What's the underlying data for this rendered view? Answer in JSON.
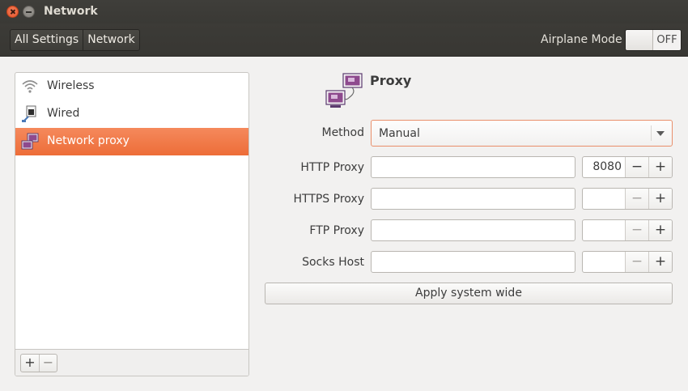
{
  "window": {
    "title": "Network"
  },
  "header": {
    "breadcrumbs": [
      "All Settings",
      "Network"
    ],
    "airplane_mode_label": "Airplane Mode",
    "airplane_mode_state": "OFF"
  },
  "sidebar": {
    "items": [
      {
        "label": "Wireless",
        "icon": "wifi-icon",
        "selected": false
      },
      {
        "label": "Wired",
        "icon": "wired-network-icon",
        "selected": false
      },
      {
        "label": "Network proxy",
        "icon": "network-proxy-icon",
        "selected": true
      }
    ],
    "add_label": "+",
    "remove_label": "−"
  },
  "proxy": {
    "title": "Proxy",
    "method_label": "Method",
    "method_value": "Manual",
    "rows": [
      {
        "label": "HTTP Proxy",
        "host": "",
        "port": "8080"
      },
      {
        "label": "HTTPS Proxy",
        "host": "",
        "port": ""
      },
      {
        "label": "FTP Proxy",
        "host": "",
        "port": ""
      },
      {
        "label": "Socks Host",
        "host": "",
        "port": ""
      }
    ],
    "spin_minus": "−",
    "spin_plus": "+",
    "apply_label": "Apply system wide"
  },
  "colors": {
    "selection": "#ef7540",
    "titlebar": "#3c3b37",
    "close_button": "#e95420"
  }
}
